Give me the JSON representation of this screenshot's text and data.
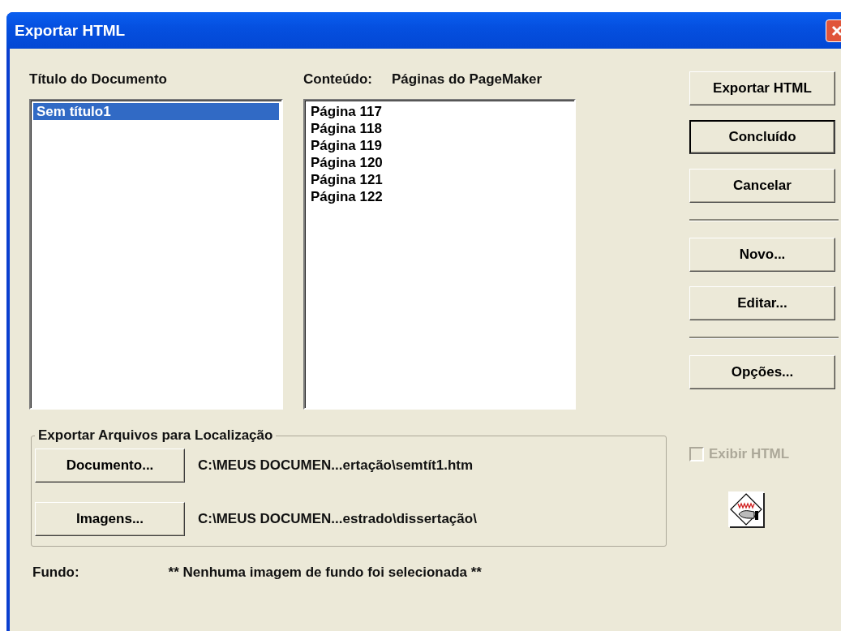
{
  "window": {
    "title": "Exportar HTML"
  },
  "document_title": {
    "label": "Título do Documento",
    "items": [
      {
        "label": "Sem título1",
        "selected": true
      }
    ]
  },
  "content": {
    "label": "Conteúdo:",
    "source": "Páginas do PageMaker",
    "items": [
      {
        "label": "Página 117",
        "selected": false
      },
      {
        "label": "Página 118",
        "selected": false
      },
      {
        "label": "Página 119",
        "selected": false
      },
      {
        "label": "Página 120",
        "selected": false
      },
      {
        "label": "Página 121",
        "selected": false
      },
      {
        "label": "Página 122",
        "selected": false
      }
    ]
  },
  "side_buttons": [
    {
      "kind": "button",
      "label": "Exportar HTML",
      "default": false
    },
    {
      "kind": "button",
      "label": "Concluído",
      "default": true
    },
    {
      "kind": "button",
      "label": "Cancelar",
      "default": false
    },
    {
      "kind": "separator"
    },
    {
      "kind": "button",
      "label": "Novo...",
      "default": false
    },
    {
      "kind": "button",
      "label": "Editar...",
      "default": false
    },
    {
      "kind": "separator"
    },
    {
      "kind": "button",
      "label": "Opções...",
      "default": false
    }
  ],
  "export_group": {
    "legend": "Exportar Arquivos para Localização",
    "rows": [
      {
        "button": "Documento...",
        "path": "C:\\MEUS DOCUMEN...ertação\\semtít1.htm"
      },
      {
        "button": "Imagens...",
        "path": "C:\\MEUS DOCUMEN...estrado\\dissertação\\"
      }
    ]
  },
  "show_html": {
    "label": "Exibir HTML",
    "checked": false,
    "disabled": true
  },
  "background": {
    "label": "Fundo:",
    "value": "** Nenhuma imagem de fundo foi selecionada **"
  }
}
